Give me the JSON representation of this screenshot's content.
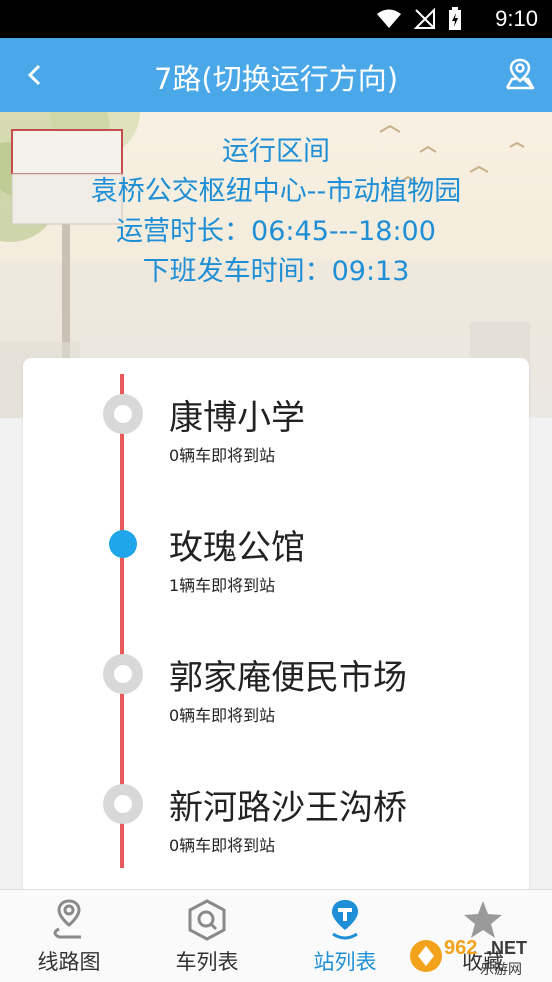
{
  "status_bar": {
    "time": "9:10"
  },
  "header": {
    "title": "7路(切换运行方向)"
  },
  "route_info": {
    "section_label": "运行区间",
    "section_value": "袁桥公交枢纽中心--市动植物园",
    "hours": "运营时长：06:45---18:00",
    "next_departure": "下班发车时间：09:13"
  },
  "stops": [
    {
      "name": "康博小学",
      "status": "0辆车即将到站",
      "active": false
    },
    {
      "name": "玫瑰公馆",
      "status": "1辆车即将到站",
      "active": true
    },
    {
      "name": "郭家庵便民市场",
      "status": "0辆车即将到站",
      "active": false
    },
    {
      "name": "新河路沙王沟桥",
      "status": "0辆车即将到站",
      "active": false
    }
  ],
  "bottom_nav": {
    "tabs": [
      {
        "label": "线路图",
        "icon": "route-map-icon"
      },
      {
        "label": "车列表",
        "icon": "bus-list-icon"
      },
      {
        "label": "站列表",
        "icon": "station-list-icon",
        "active": true
      },
      {
        "label": "收藏",
        "icon": "star-icon"
      }
    ]
  },
  "watermark": {
    "text": "962.NET",
    "subtext": "乐游网"
  },
  "colors": {
    "header": "#4aa8e8",
    "accent": "#1e8fd6",
    "rail": "#e85a5a"
  }
}
